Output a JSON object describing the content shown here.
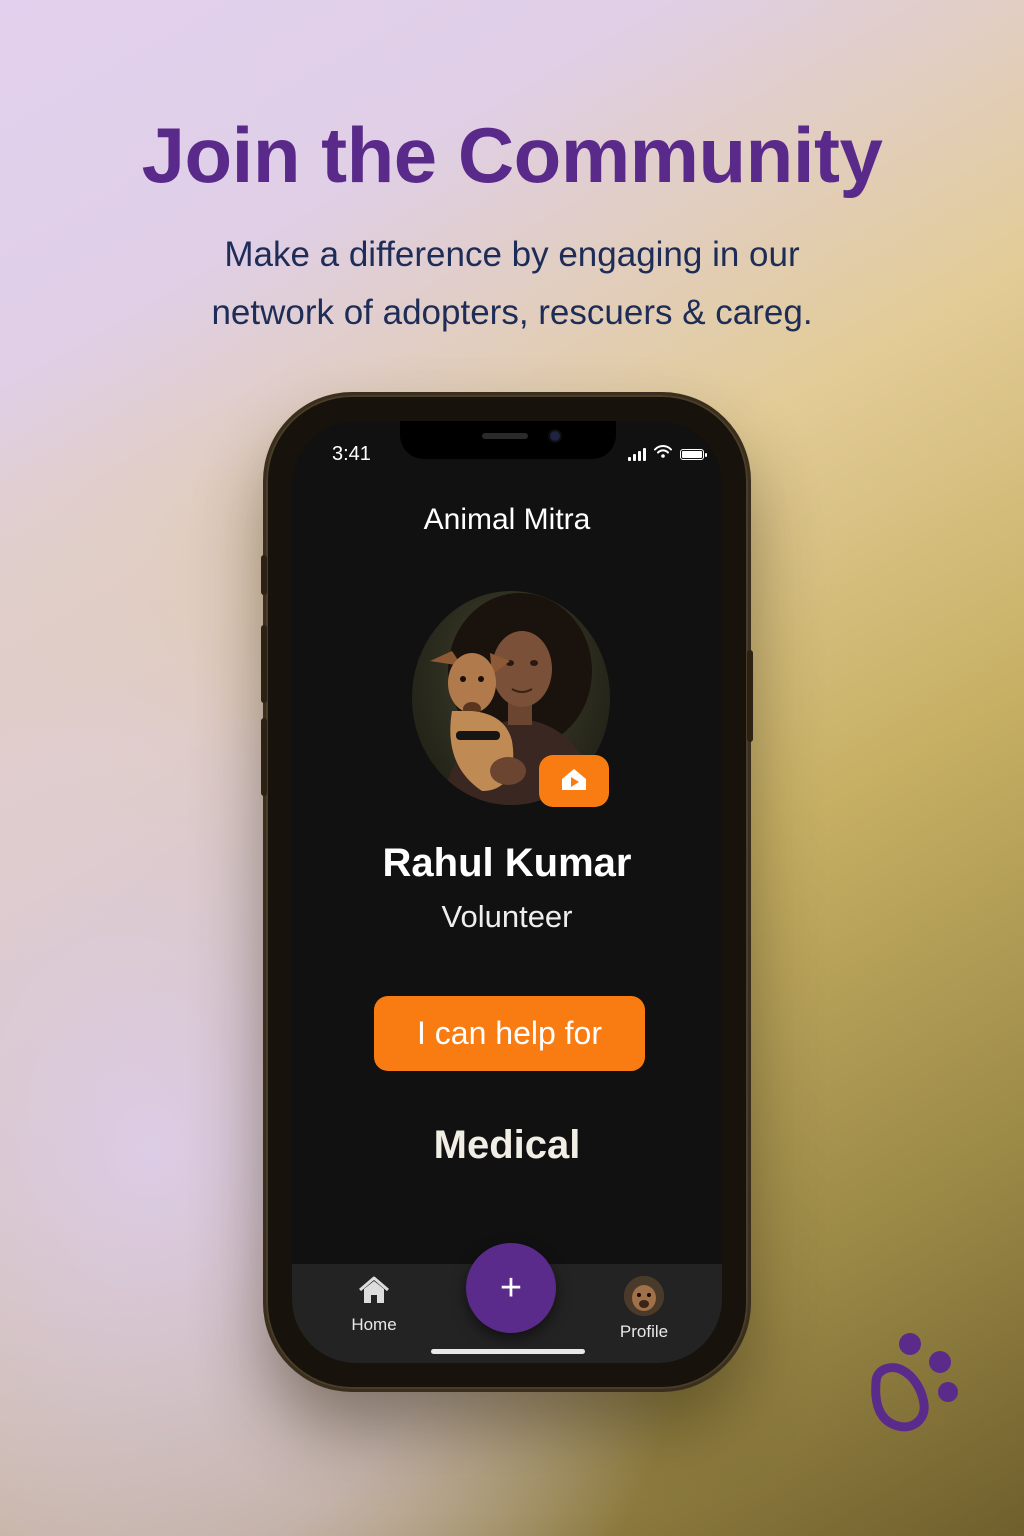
{
  "poster": {
    "headline": "Join the Community",
    "subtitle_line1": "Make a difference by engaging in our",
    "subtitle_line2": "network of adopters, rescuers & careg."
  },
  "status_bar": {
    "time": "3:41",
    "icons": [
      "signal-icon",
      "wifi-icon",
      "battery-icon"
    ]
  },
  "app": {
    "title": "Animal Mitra",
    "profile": {
      "name": "Rahul Kumar",
      "role": "Volunteer",
      "avatar": "user-with-dog-photo",
      "badge_icon": "home-icon"
    },
    "help_button_label": "I can help for",
    "help_category": "Medical"
  },
  "tab_bar": {
    "home_label": "Home",
    "profile_label": "Profile",
    "add_button_label": "+"
  },
  "colors": {
    "accent_orange": "#f97c12",
    "brand_purple": "#5b2b8b",
    "screen_bg": "#111111"
  }
}
